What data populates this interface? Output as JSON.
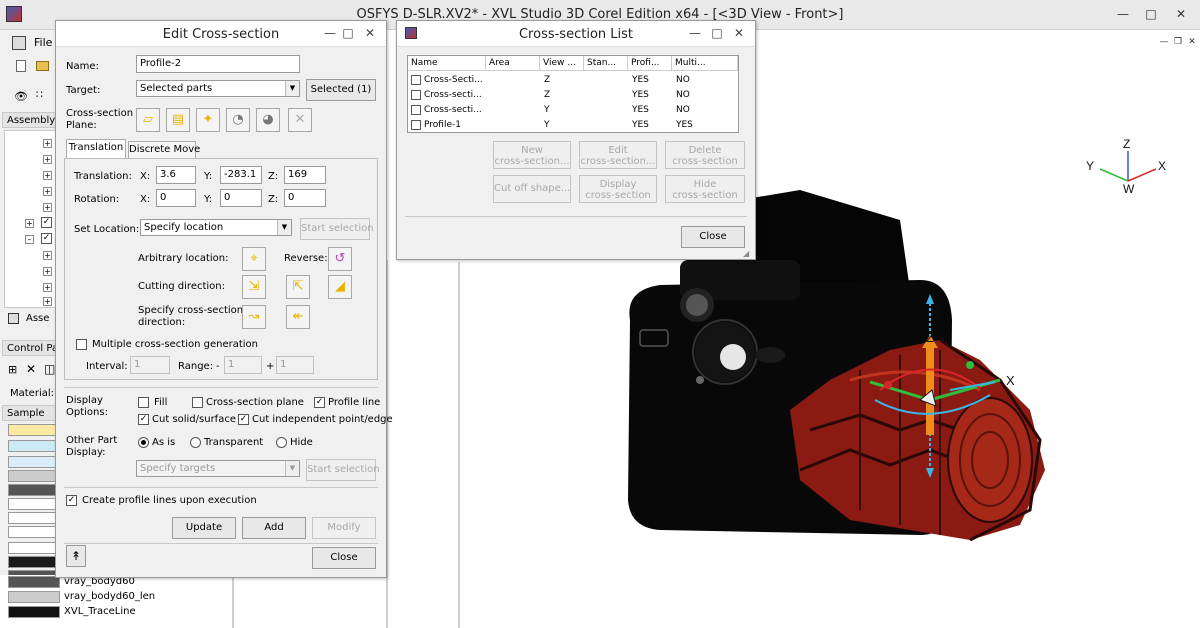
{
  "window": {
    "title": "OSFYS D-SLR.XV2* - XVL Studio 3D Corel Edition x64 - [<3D View - Front>]"
  },
  "menu": {
    "file": "File"
  },
  "left_panel": {
    "assembly_tab": "Assembly",
    "assembly_tab2": "Asse",
    "control_panel": "Control Pa",
    "material_label": "Material:",
    "sample_label": "Sample"
  },
  "materials": [
    {
      "name": "vray_bodyd60",
      "color": "#555555"
    },
    {
      "name": "vray_bodyd60_len",
      "color": "#cccccc"
    },
    {
      "name": "XVL_TraceLine",
      "color": "#111111"
    }
  ],
  "swatches": [
    "#fce9a2",
    "#cde9f5",
    "#d9eef9",
    "#cccccc",
    "#555555",
    "#ffffff",
    "#ffffff",
    "#ffffff",
    "#ffffff",
    "#1a1a1a",
    "#555555",
    "#333333",
    "#888888"
  ],
  "edit_dialog": {
    "title": "Edit Cross-section",
    "name_label": "Name:",
    "name_value": "Profile-2",
    "target_label": "Target:",
    "target_value": "Selected parts",
    "selected_button": "Selected (1)",
    "plane_label_1": "Cross-section",
    "plane_label_2": "Plane:",
    "tab_translation": "Translation",
    "tab_discrete": "Discrete Move",
    "translation_label": "Translation:",
    "rotation_label": "Rotation:",
    "x": "X:",
    "y": "Y:",
    "z": "Z:",
    "tx": "3.6",
    "ty": "-283.1",
    "tz": "169",
    "rx": "0",
    "ry": "0",
    "rz": "0",
    "set_location_label": "Set Location:",
    "set_location_value": "Specify location",
    "start_selection": "Start selection",
    "arbitrary_location": "Arbitrary location:",
    "reverse": "Reverse:",
    "cutting_direction": "Cutting direction:",
    "specify_dir_1": "Specify cross-section",
    "specify_dir_2": "direction:",
    "multiple": "Multiple cross-section generation",
    "interval_label": "Interval:",
    "interval_value": "1",
    "range_label": "Range:",
    "range_minus": "-",
    "range_value": "1",
    "range_plus": "+",
    "range_value2": "1",
    "display_label_1": "Display",
    "display_label_2": "Options:",
    "fill": "Fill",
    "cs_plane": "Cross-section plane",
    "profile_line": "Profile line",
    "cut_solid": "Cut solid/surface",
    "cut_independent": "Cut independent point/edge",
    "other_label_1": "Other Part",
    "other_label_2": "Display:",
    "as_is": "As is",
    "transparent": "Transparent",
    "hide": "Hide",
    "specify_targets": "Specify targets",
    "start_selection2": "Start selection",
    "create_profile": "Create profile lines upon execution",
    "update": "Update",
    "add": "Add",
    "modify": "Modify",
    "close": "Close",
    "collapse_icon": "double-chevron-up-icon"
  },
  "list_dialog": {
    "title": "Cross-section List",
    "columns": [
      "Name",
      "Area",
      "View ...",
      "Stan...",
      "Profi...",
      "Multi..."
    ],
    "rows": [
      {
        "name": "Cross-Secti...",
        "area": "",
        "view": "Z",
        "stan": "",
        "profile": "YES",
        "multi": "NO"
      },
      {
        "name": "Cross-secti...",
        "area": "",
        "view": "Z",
        "stan": "",
        "profile": "YES",
        "multi": "NO"
      },
      {
        "name": "Cross-secti...",
        "area": "",
        "view": "Y",
        "stan": "",
        "profile": "YES",
        "multi": "NO"
      },
      {
        "name": "Profile-1",
        "area": "",
        "view": "Y",
        "stan": "",
        "profile": "YES",
        "multi": "YES"
      }
    ],
    "new_1": "New",
    "new_2": "cross-section...",
    "edit_1": "Edit",
    "edit_2": "cross-section...",
    "delete_1": "Delete",
    "delete_2": "cross-section",
    "cut_off": "Cut off shape...",
    "display_1": "Display",
    "display_2": "cross-section",
    "hide_1": "Hide",
    "hide_2": "cross-section",
    "close": "Close"
  },
  "axes": {
    "z": "Z",
    "y": "Y",
    "x": "X",
    "w": "W"
  },
  "gizmo": {
    "z": "Z",
    "x": "X"
  },
  "colors": {
    "accent_red": "#8b1a12",
    "gizmo_orange": "#f08c1c",
    "gizmo_cyan": "#3bb7e6",
    "gizmo_green": "#2fbd3a"
  }
}
